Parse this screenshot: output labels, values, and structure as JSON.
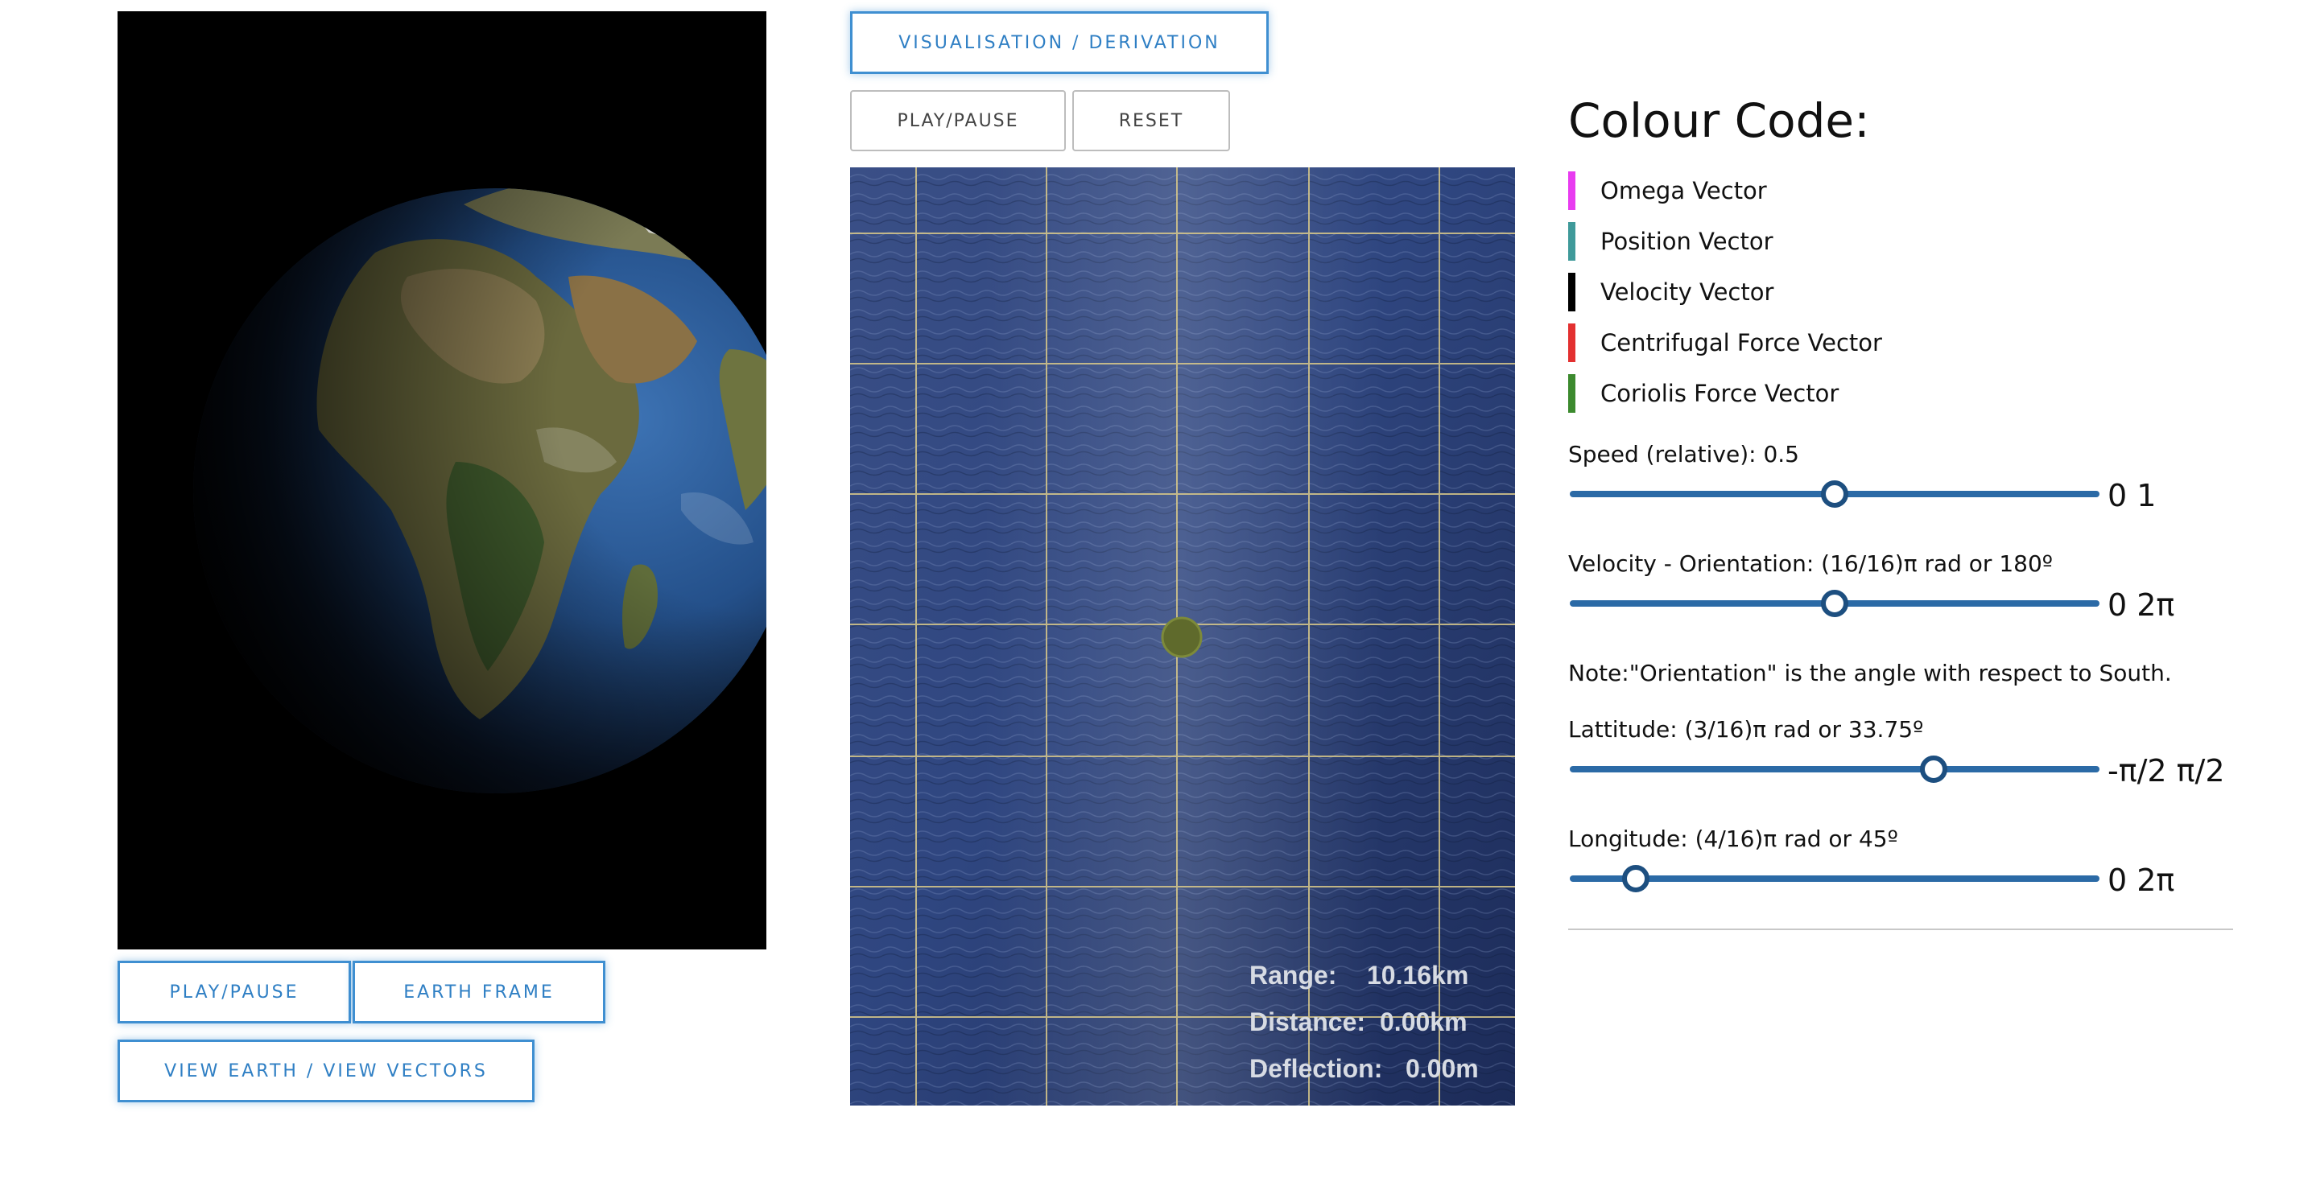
{
  "left_panel": {
    "play_pause_label": "PLAY/PAUSE",
    "earth_frame_label": "EARTH FRAME",
    "view_toggle_label": "VIEW EARTH / VIEW VECTORS"
  },
  "center_panel": {
    "mode_toggle_label": "VISUALISATION / DERIVATION",
    "play_pause_label": "PLAY/PAUSE",
    "reset_label": "RESET",
    "readouts": {
      "range_label": "Range:",
      "range_value": "10.16km",
      "distance_label": "Distance:",
      "distance_value": "0.00km",
      "deflection_label": "Deflection:",
      "deflection_value": "0.00m"
    }
  },
  "right_panel": {
    "colour_code_title": "Colour Code:",
    "legend": [
      {
        "label": "Omega Vector",
        "color": "#e83cf0"
      },
      {
        "label": "Position Vector",
        "color": "#3f9a9a"
      },
      {
        "label": "Velocity Vector",
        "color": "#000000"
      },
      {
        "label": "Centrifugal Force Vector",
        "color": "#e33030"
      },
      {
        "label": "Coriolis Force Vector",
        "color": "#3c8a2e"
      }
    ],
    "sliders": {
      "speed": {
        "label": "Speed (relative): 0.5",
        "min_label": "0",
        "max_label": "1",
        "range_label": "0 1",
        "fraction": 0.5
      },
      "orientation": {
        "label": "Velocity - Orientation: (16/16)π rad or 180º",
        "range_label": "0 2π",
        "fraction": 0.5
      },
      "latitude": {
        "label": "Lattitude: (3/16)π rad or 33.75º",
        "range_label": "-π/2 π/2",
        "fraction": 0.6875
      },
      "longitude": {
        "label": "Longitude: (4/16)π rad or 45º",
        "range_label": "0 2π",
        "fraction": 0.125
      }
    },
    "note": "Note:\"Orientation\" is the angle with respect to South."
  },
  "colors": {
    "accent_blue": "#3f8fd1",
    "slider_track": "#2b6aa6",
    "grid_line": "#d9c98a",
    "ocean": "#243a6e",
    "puck": "#5f6a2c"
  }
}
